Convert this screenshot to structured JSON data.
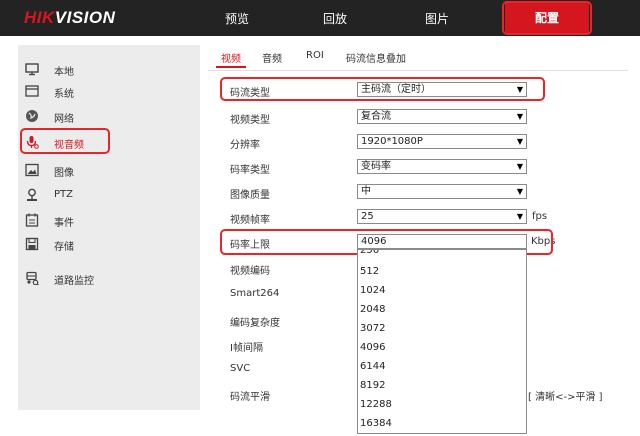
{
  "logo": {
    "brand_red": "HIK",
    "brand_white": "VISION"
  },
  "nav": {
    "preview": "预览",
    "playback": "回放",
    "picture": "图片",
    "config": "配置"
  },
  "sidebar": {
    "items": [
      {
        "label": "本地",
        "icon": "monitor-icon"
      },
      {
        "label": "系统",
        "icon": "system-icon"
      },
      {
        "label": "网络",
        "icon": "globe-icon"
      },
      {
        "label": "视音频",
        "icon": "mic-icon"
      },
      {
        "label": "图像",
        "icon": "image-icon"
      },
      {
        "label": "PTZ",
        "icon": "ptz-icon"
      },
      {
        "label": "事件",
        "icon": "calendar-icon"
      },
      {
        "label": "存储",
        "icon": "save-icon"
      },
      {
        "label": "道路监控",
        "icon": "car-icon"
      }
    ]
  },
  "tabs": {
    "video": "视频",
    "audio": "音频",
    "roi": "ROI",
    "overlay": "码流信息叠加"
  },
  "form": {
    "stream_type": {
      "label": "码流类型",
      "value": "主码流（定时）"
    },
    "video_type": {
      "label": "视频类型",
      "value": "复合流"
    },
    "resolution": {
      "label": "分辨率",
      "value": "1920*1080P"
    },
    "bitrate_type": {
      "label": "码率类型",
      "value": "变码率"
    },
    "image_quality": {
      "label": "图像质量",
      "value": "中"
    },
    "frame_rate": {
      "label": "视频帧率",
      "value": "25",
      "unit": "fps"
    },
    "bitrate_cap": {
      "label": "码率上限",
      "value": "4096",
      "unit": "Kbps"
    },
    "video_encoding": {
      "label": "视频编码"
    },
    "smart264": {
      "label": "Smart264"
    },
    "complexity": {
      "label": "编码复杂度"
    },
    "i_frame": {
      "label": "I帧间隔"
    },
    "svc": {
      "label": "SVC"
    },
    "smoothing": {
      "label": "码流平滑",
      "hint": "[ 清晰<->平滑 ]"
    }
  },
  "dropdown_options": [
    "256",
    "512",
    "1024",
    "2048",
    "3072",
    "4096",
    "6144",
    "8192",
    "12288",
    "16384"
  ],
  "colors": {
    "accent": "#d6161e",
    "topbar": "#232323",
    "sidebar": "#ececec",
    "highlight_box": "#e6262b"
  }
}
